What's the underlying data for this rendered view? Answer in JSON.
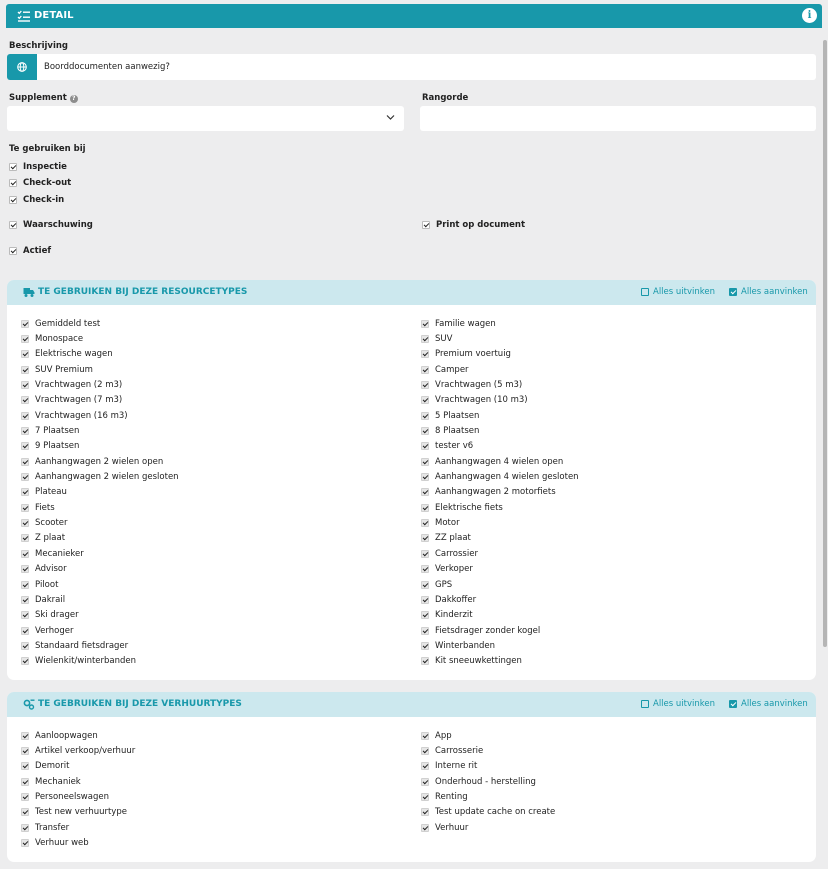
{
  "header": {
    "title": "DETAIL",
    "info_glyph": "i"
  },
  "beschrijving": {
    "label": "Beschrijving",
    "value": "Boorddocumenten aanwezig?"
  },
  "supplement": {
    "label": "Supplement",
    "help_glyph": "?",
    "value": ""
  },
  "rangorde": {
    "label": "Rangorde",
    "value": ""
  },
  "te_gebruiken_bij": {
    "label": "Te gebruiken bij",
    "items": [
      "Inspectie",
      "Check-out",
      "Check-in"
    ]
  },
  "waarschuwing": "Waarschuwing",
  "print_op_document": "Print op document",
  "actief": "Actief",
  "resourcetypes": {
    "title": "TE GEBRUIKEN BIJ DEZE RESOURCETYPES",
    "uncheck_all": "Alles uitvinken",
    "check_all": "Alles aanvinken",
    "left": [
      "Gemiddeld test",
      "Monospace",
      "Elektrische wagen",
      "SUV Premium",
      "Vrachtwagen (2 m3)",
      "Vrachtwagen (7 m3)",
      "Vrachtwagen (16 m3)",
      "7 Plaatsen",
      "9 Plaatsen",
      "Aanhangwagen 2 wielen open",
      "Aanhangwagen 2 wielen gesloten",
      "Plateau",
      "Fiets",
      "Scooter",
      "Z plaat",
      "Mecanieker",
      "Advisor",
      "Piloot",
      "Dakrail",
      "Ski drager",
      "Verhoger",
      "Standaard fietsdrager",
      "Wielenkit/winterbanden"
    ],
    "right": [
      "Familie wagen",
      "SUV",
      "Premium voertuig",
      "Camper",
      "Vrachtwagen (5 m3)",
      "Vrachtwagen (10 m3)",
      "5 Plaatsen",
      "8 Plaatsen",
      "tester v6",
      "Aanhangwagen 4 wielen open",
      "Aanhangwagen 4 wielen gesloten",
      "Aanhangwagen 2 motorfiets",
      "Elektrische fiets",
      "Motor",
      "ZZ plaat",
      "Carrossier",
      "Verkoper",
      "GPS",
      "Dakkoffer",
      "Kinderzit",
      "Fietsdrager zonder kogel",
      "Winterbanden",
      "Kit sneeuwkettingen"
    ]
  },
  "verhuurtypes": {
    "title": "TE GEBRUIKEN BIJ DEZE VERHUURTYPES",
    "uncheck_all": "Alles uitvinken",
    "check_all": "Alles aanvinken",
    "left": [
      "Aanloopwagen",
      "Artikel verkoop/verhuur",
      "Demorit",
      "Mechaniek",
      "Personeelswagen",
      "Test new verhuurtype",
      "Transfer",
      "Verhuur web"
    ],
    "right": [
      "App",
      "Carrosserie",
      "Interne rit",
      "Onderhoud - herstelling",
      "Renting",
      "Test update cache on create",
      "Verhuur"
    ]
  },
  "colors": {
    "accent": "#1898aa",
    "panel_header": "#cce8ee",
    "background": "#ededee"
  }
}
